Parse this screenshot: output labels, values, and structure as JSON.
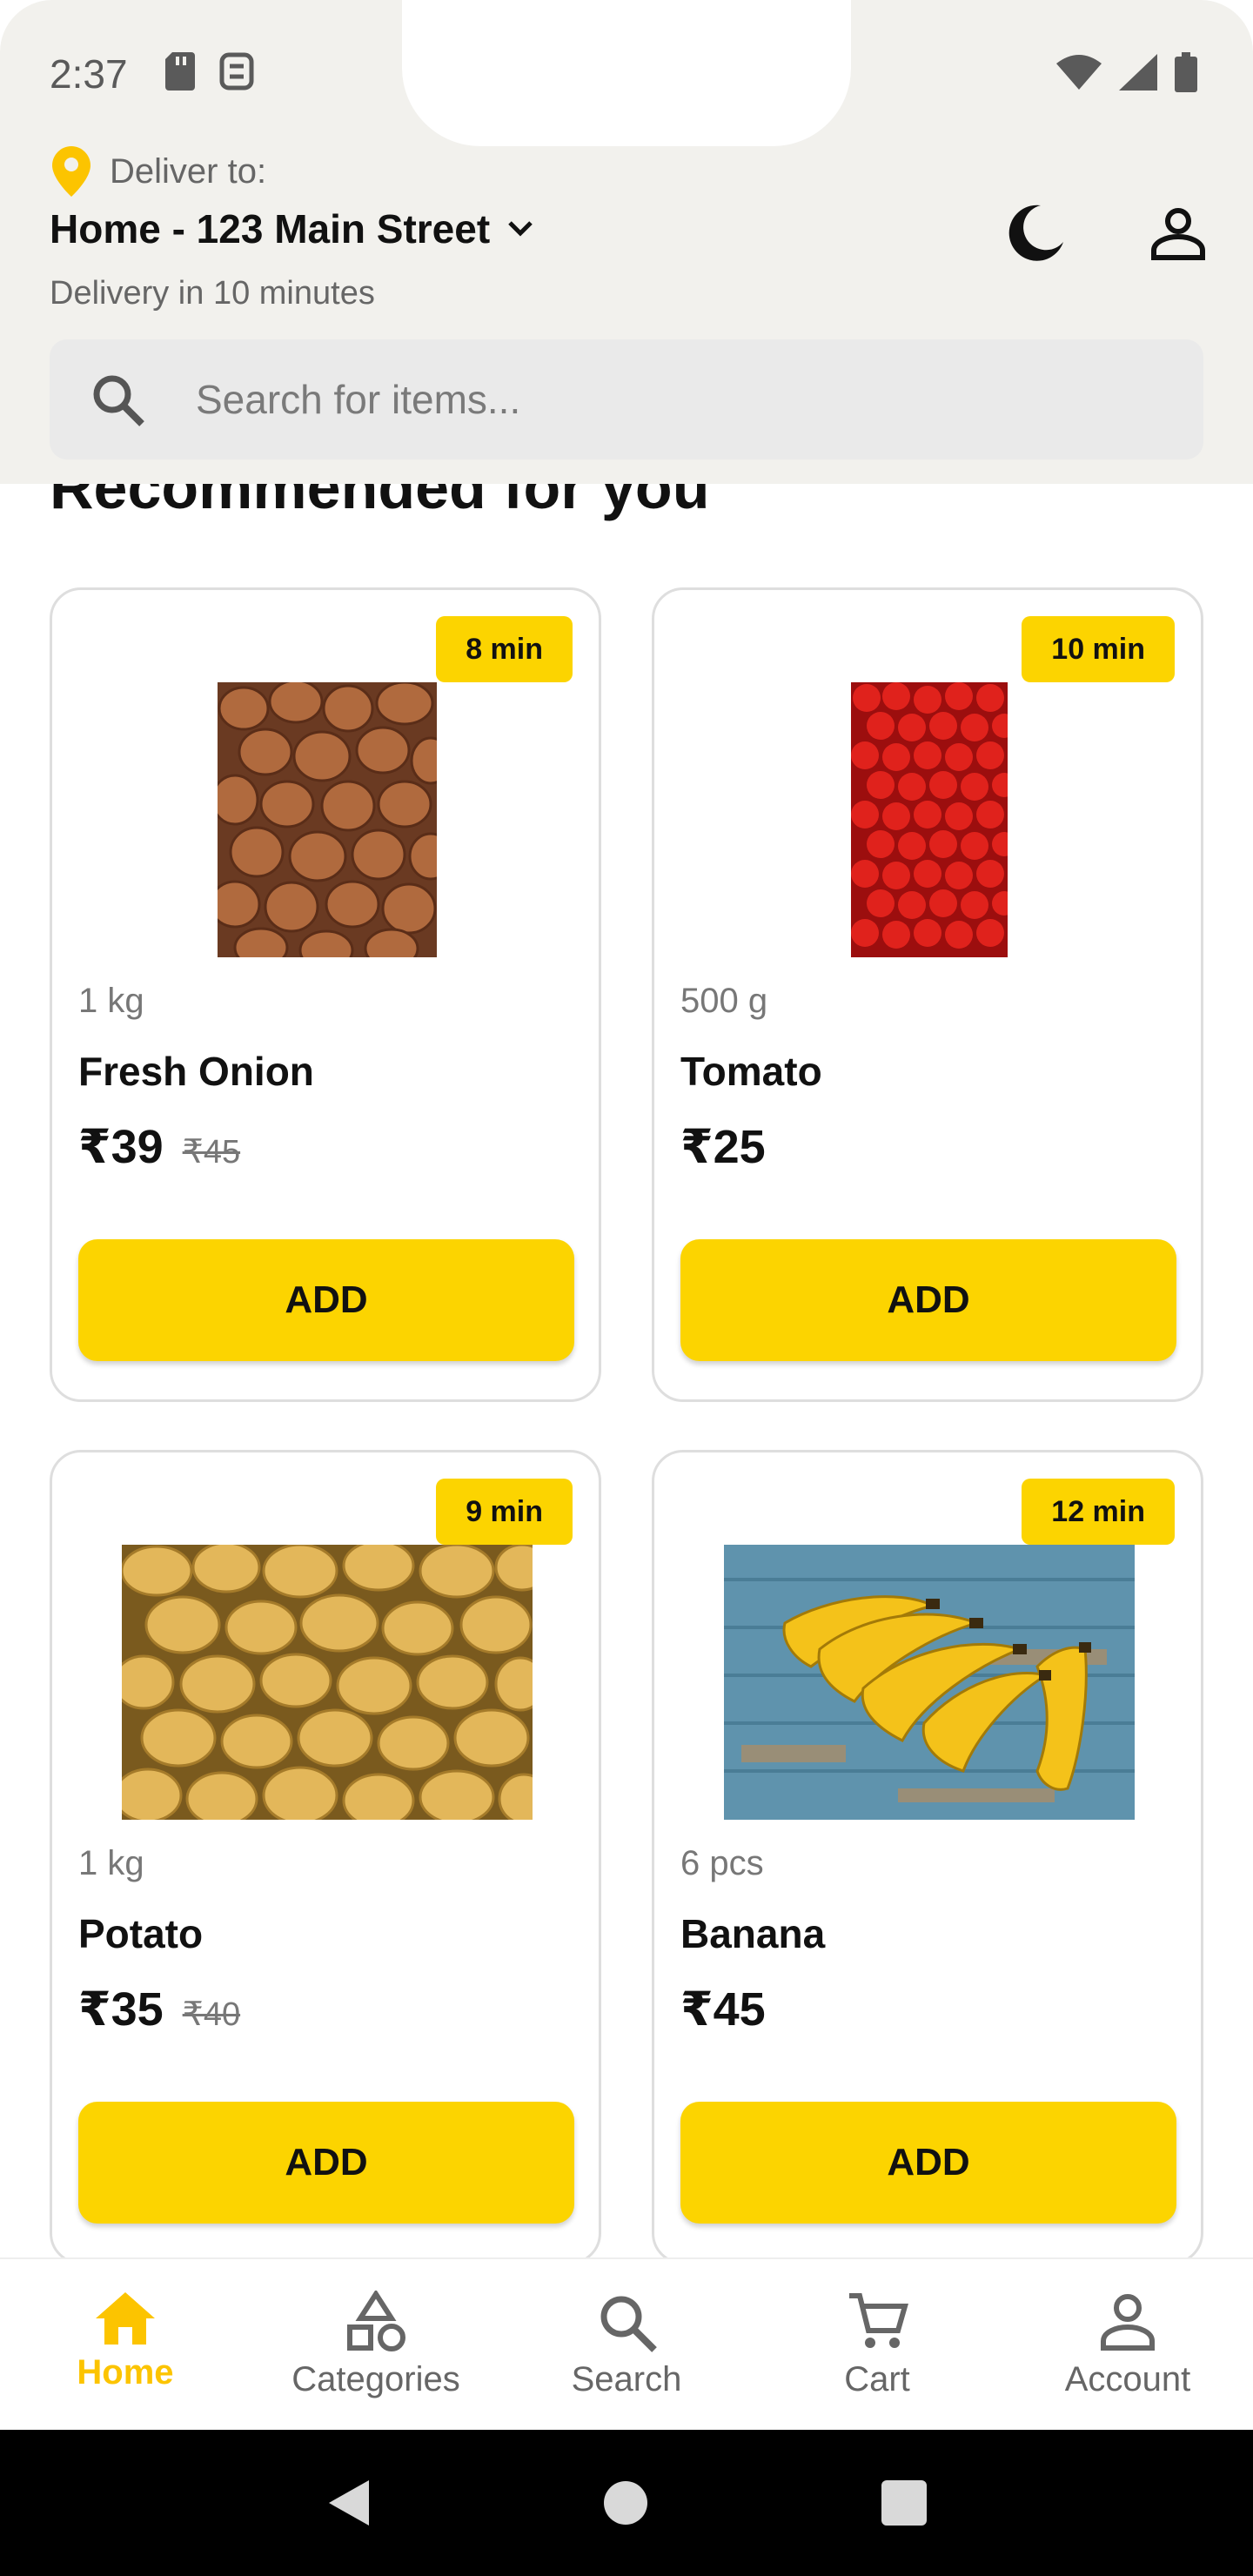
{
  "status_bar": {
    "time": "2:37"
  },
  "header": {
    "deliver_label": "Deliver to:",
    "address": "Home - 123 Main Street",
    "eta": "Delivery in 10 minutes"
  },
  "search": {
    "placeholder": "Search for items..."
  },
  "section": {
    "title": "Recommended for you"
  },
  "products": [
    {
      "badge": "8 min",
      "qty": "1 kg",
      "name": "Fresh Onion",
      "price": "₹39",
      "mrp": "₹45",
      "add": "ADD"
    },
    {
      "badge": "10 min",
      "qty": "500 g",
      "name": "Tomato",
      "price": "₹25",
      "mrp": "",
      "add": "ADD"
    },
    {
      "badge": "9 min",
      "qty": "1 kg",
      "name": "Potato",
      "price": "₹35",
      "mrp": "₹40",
      "add": "ADD"
    },
    {
      "badge": "12 min",
      "qty": "6 pcs",
      "name": "Banana",
      "price": "₹45",
      "mrp": "",
      "add": "ADD"
    }
  ],
  "bottom_nav": [
    {
      "label": "Home",
      "active": true
    },
    {
      "label": "Categories"
    },
    {
      "label": "Search"
    },
    {
      "label": "Cart"
    },
    {
      "label": "Account"
    }
  ],
  "colors": {
    "accent": "#fcd400",
    "header_bg": "#f2f1ed"
  }
}
